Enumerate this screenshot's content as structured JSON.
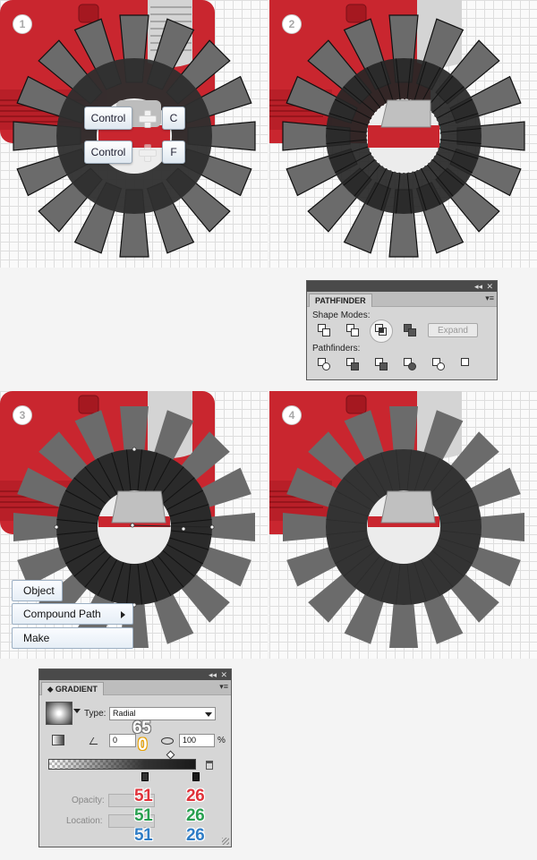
{
  "steps": {
    "s1": "1",
    "s2": "2",
    "s3": "3",
    "s4": "4"
  },
  "shortcuts": {
    "copy": {
      "modifier": "Control",
      "key": "C"
    },
    "paste_front": {
      "modifier": "Control",
      "key": "F"
    }
  },
  "pathfinder": {
    "tab": "PATHFINDER",
    "shape_modes_label": "Shape Modes:",
    "pathfinders_label": "Pathfinders:",
    "expand_label": "Expand",
    "titlebar_collapse": "◂◂",
    "titlebar_close": "✕",
    "menu": "▾≡",
    "selected_mode": "intersect"
  },
  "context_menu": {
    "items": [
      "Object",
      "Compound Path",
      "Make"
    ]
  },
  "gradient": {
    "tab": "GRADIENT",
    "tab_prefix": "⬥",
    "type_label": "Type:",
    "type_value": "Radial",
    "angle_value": "0",
    "aspect_value": "100",
    "percent": "%",
    "opacity_label": "Opacity:",
    "location_label": "Location:",
    "titlebar_collapse": "◂◂",
    "titlebar_close": "✕",
    "menu": "▾≡",
    "stop1_rgb": {
      "r": "51",
      "g": "51",
      "b": "51"
    },
    "stop2_rgb": {
      "r": "26",
      "g": "26",
      "b": "26"
    },
    "location_annot_top": "65",
    "location_annot_bottom": "0"
  },
  "colors": {
    "red_body": "#c9262f",
    "ring": "#333333",
    "blade": "#6b6b6b",
    "annot_red": "#e0323a",
    "annot_green": "#28a050",
    "annot_blue": "#2f7dc6"
  }
}
